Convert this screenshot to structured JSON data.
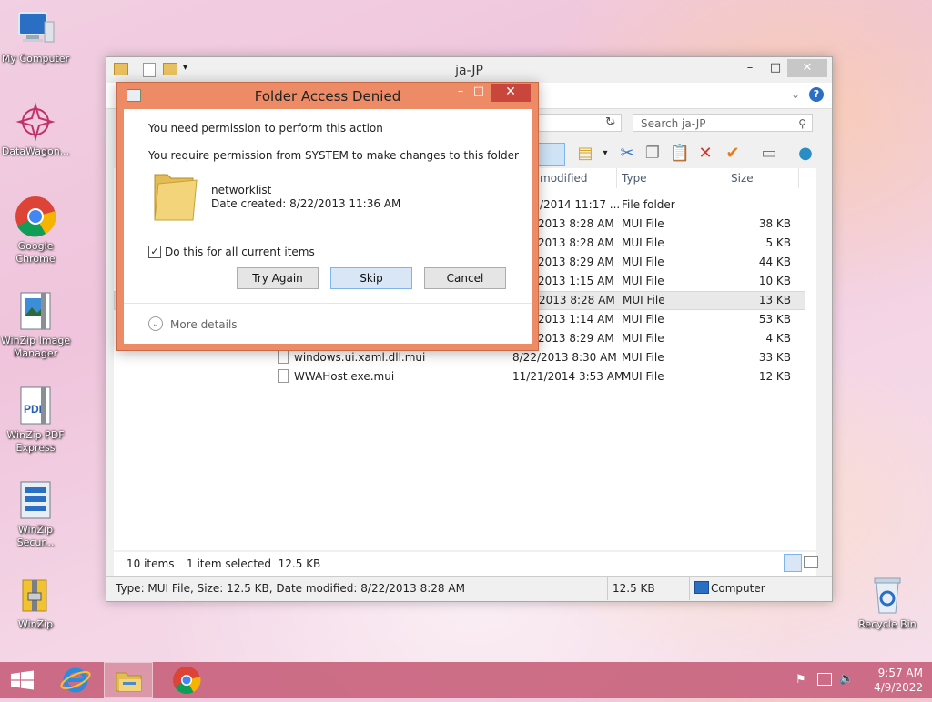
{
  "desktop": {
    "icons": [
      {
        "label": "My Computer",
        "icon": "computer-icon"
      },
      {
        "label": "DataWagon...",
        "icon": "datawagon-icon"
      },
      {
        "label": "Google Chrome",
        "icon": "chrome-icon"
      },
      {
        "label": "WinZip Image Manager",
        "icon": "winzip-image-icon"
      },
      {
        "label": "WinZip PDF Express",
        "icon": "pdf-icon"
      },
      {
        "label": "WinZip Secur...",
        "icon": "winzip-secure-icon"
      },
      {
        "label": "WinZip",
        "icon": "winzip-icon"
      },
      {
        "label": "Recycle Bin",
        "icon": "recycle-bin-icon"
      }
    ]
  },
  "explorer": {
    "title": "ja-JP",
    "search_placeholder": "Search ja-JP",
    "columns": {
      "modified": "modified",
      "type": "Type",
      "size": "Size"
    },
    "rows": [
      {
        "name": "",
        "date": "/2014 11:17 ...",
        "type": "File folder",
        "size": ""
      },
      {
        "name": "",
        "date": "2013 8:28 AM",
        "type": "MUI File",
        "size": "38 KB"
      },
      {
        "name": "",
        "date": "2013 8:28 AM",
        "type": "MUI File",
        "size": "5 KB"
      },
      {
        "name": "",
        "date": "2013 8:29 AM",
        "type": "MUI File",
        "size": "44 KB"
      },
      {
        "name": "",
        "date": "2013 1:15 AM",
        "type": "MUI File",
        "size": "10 KB"
      },
      {
        "name": "",
        "date": "2013 8:28 AM",
        "type": "MUI File",
        "size": "13 KB",
        "selected": true
      },
      {
        "name": "",
        "date": "2013 1:14 AM",
        "type": "MUI File",
        "size": "53 KB"
      },
      {
        "name": "",
        "date": "2013 8:29 AM",
        "type": "MUI File",
        "size": "4 KB"
      },
      {
        "name": "windows.ui.xaml.dll.mui",
        "date": "8/22/2013 8:30 AM",
        "type": "MUI File",
        "size": "33 KB"
      },
      {
        "name": "WWAHost.exe.mui",
        "date": "11/21/2014 3:53 AM",
        "type": "MUI File",
        "size": "12 KB"
      }
    ],
    "status_items": "10 items",
    "status_selected": "1 item selected  12.5 KB",
    "details_bar": "Type: MUI File, Size: 12.5 KB, Date modified: 8/22/2013 8:28 AM",
    "details_size": "12.5 KB",
    "details_location": "Computer"
  },
  "dialog": {
    "title": "Folder Access Denied",
    "heading": "You need permission to perform this action",
    "message": "You require permission from SYSTEM to make changes to this folder",
    "folder_name": "networklist",
    "date_created": "Date created: 8/22/2013 11:36 AM",
    "checkbox_label": "Do this for all current items",
    "checkbox_checked": true,
    "try_again": "Try Again",
    "skip": "Skip",
    "cancel": "Cancel",
    "more_details": "More details"
  },
  "taskbar": {
    "time": "9:57 AM",
    "date": "4/9/2022"
  },
  "colors": {
    "dialog_frame": "#ec8b65",
    "dialog_close": "#c9463d",
    "taskbar": "#c65c78",
    "focus_button": "#d8e6f5"
  }
}
